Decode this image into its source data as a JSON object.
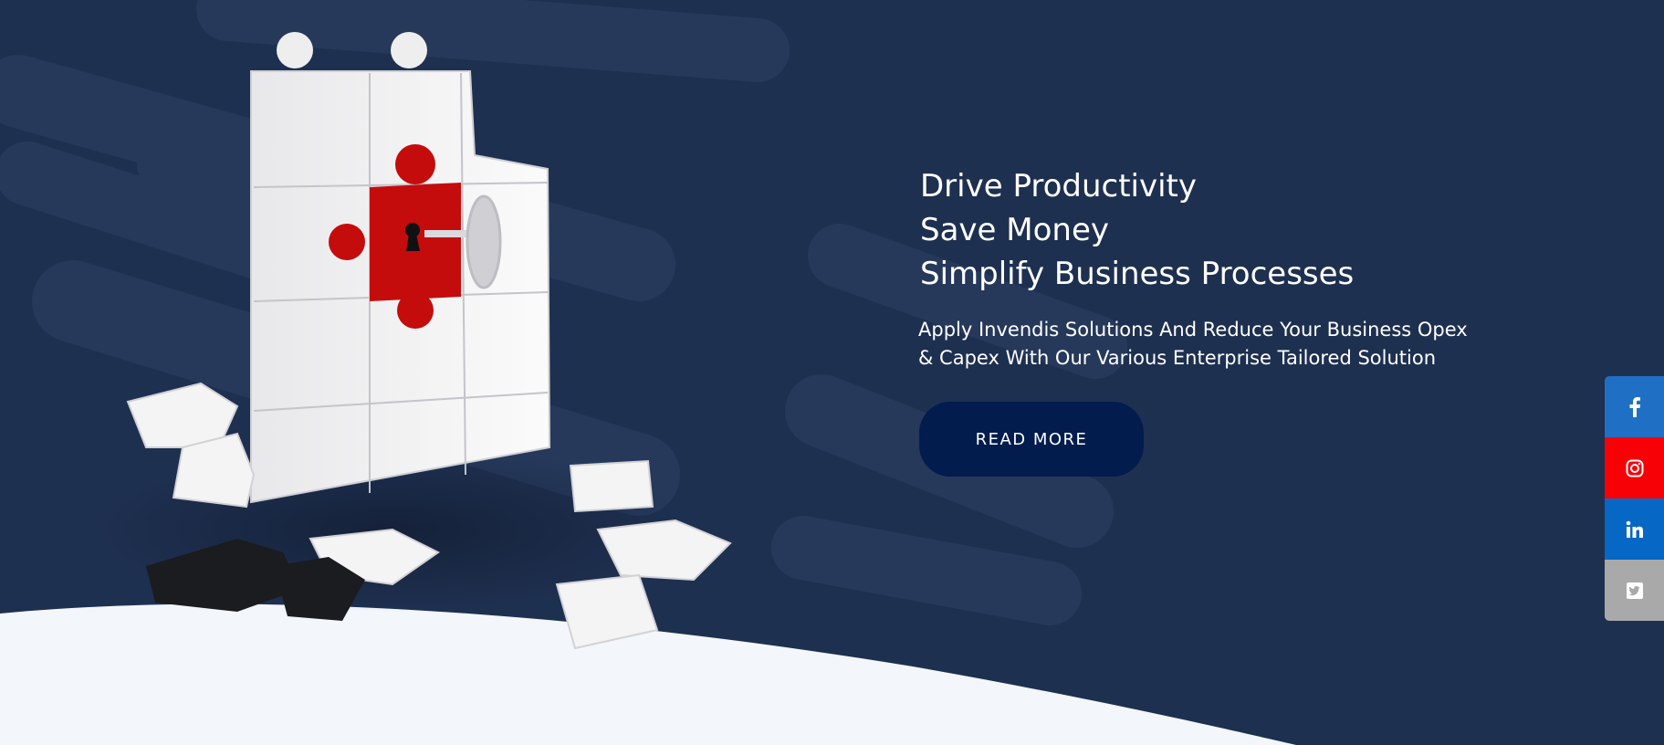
{
  "hero": {
    "headline": [
      "Drive Productivity",
      "Save Money",
      "Simplify Business Processes"
    ],
    "subtext": "Apply Invendis Solutions And Reduce Your Business Opex & Capex With Our Various Enterprise Tailored Solution",
    "cta_label": "READ MORE"
  },
  "social": [
    {
      "name": "facebook",
      "icon": "facebook-icon",
      "color": "#1f6fc5"
    },
    {
      "name": "instagram",
      "icon": "instagram-icon",
      "color": "#f70107"
    },
    {
      "name": "linkedin",
      "icon": "linkedin-icon",
      "color": "#0767c4"
    },
    {
      "name": "twitter",
      "icon": "twitter-icon",
      "color": "#a9a9a9"
    }
  ],
  "colors": {
    "background": "#1e3050",
    "button": "#011c4d",
    "wave": "#f3f6fa",
    "accent_red": "#c40c0c"
  }
}
